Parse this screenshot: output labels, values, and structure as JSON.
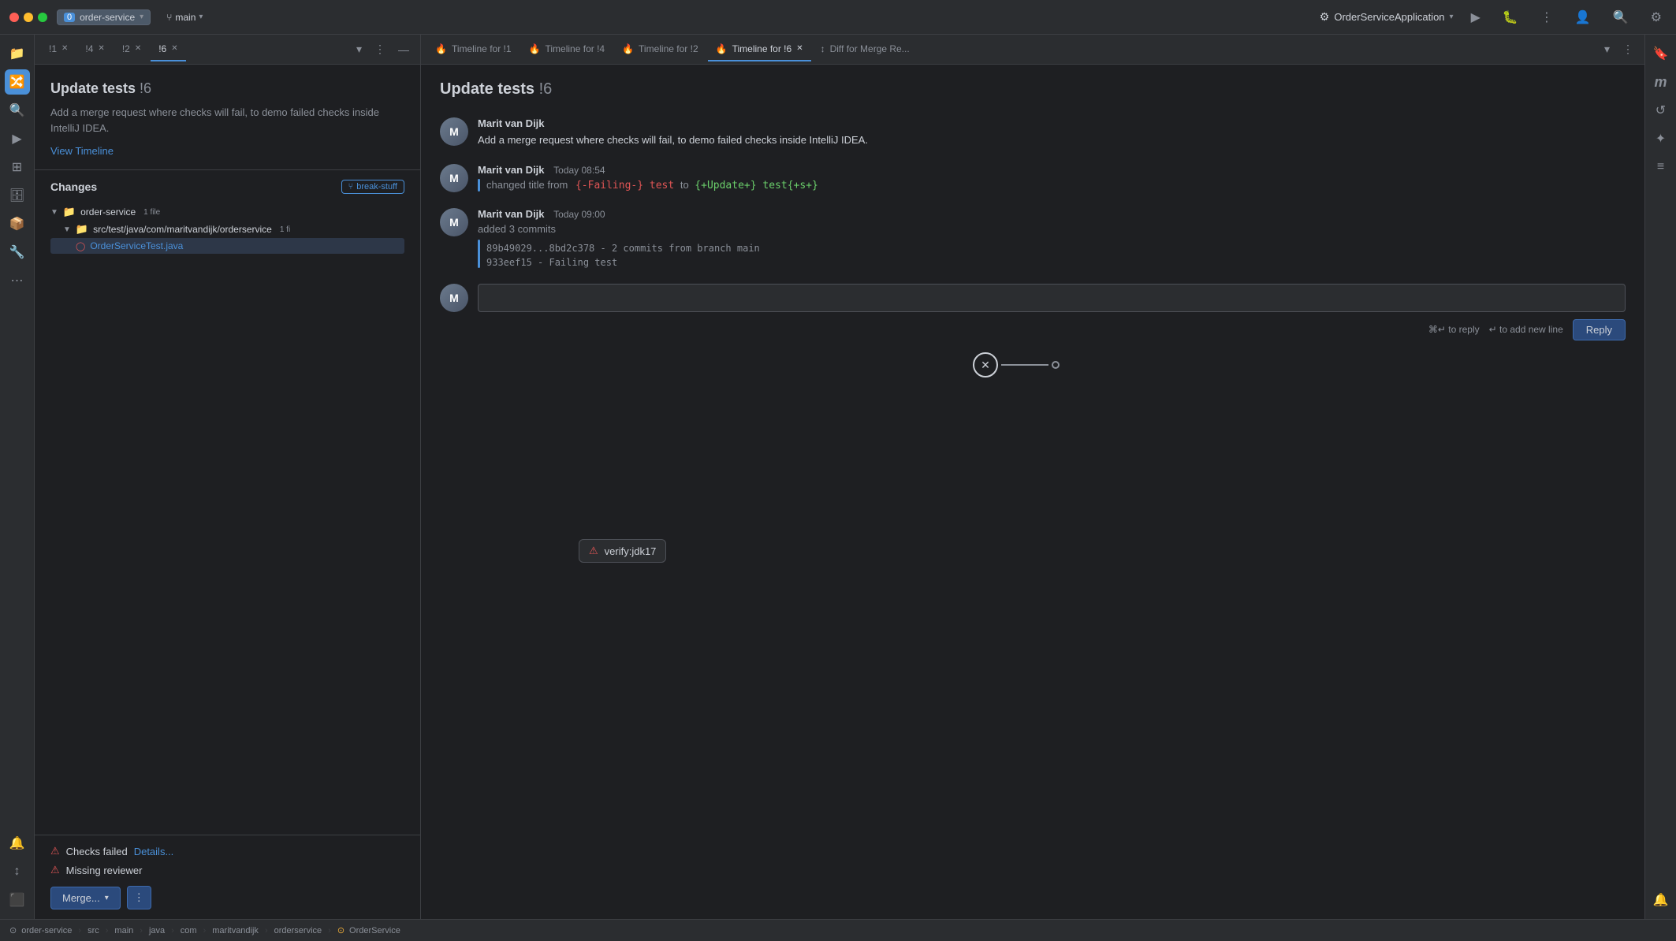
{
  "app": {
    "title": "OrderServiceApplication",
    "repo": "order-service",
    "repo_num": "0",
    "branch": "main"
  },
  "tabs": [
    {
      "id": "i1",
      "label": "!1",
      "active": false
    },
    {
      "id": "i4",
      "label": "!4",
      "active": false
    },
    {
      "id": "i2",
      "label": "!2",
      "active": false
    },
    {
      "id": "i6",
      "label": "!6",
      "active": true
    }
  ],
  "right_tabs": [
    {
      "id": "tl-i1",
      "label": "Timeline for !1",
      "active": false,
      "closeable": false
    },
    {
      "id": "tl-i4",
      "label": "Timeline for !4",
      "active": false,
      "closeable": false
    },
    {
      "id": "tl-i2",
      "label": "Timeline for !2",
      "active": false,
      "closeable": false
    },
    {
      "id": "tl-i6",
      "label": "Timeline for !6",
      "active": true,
      "closeable": true
    },
    {
      "id": "diff-mr",
      "label": "Diff for Merge Re...",
      "active": false,
      "closeable": false
    }
  ],
  "mr": {
    "title": "Update tests",
    "number": "!6",
    "description": "Add a merge request where checks will fail, to demo failed checks inside IntelliJ IDEA.",
    "view_timeline": "View Timeline",
    "changes_title": "Changes",
    "branch_tag": "break-stuff"
  },
  "file_tree": {
    "root": "order-service",
    "root_badge": "1 file",
    "folder": "src/test/java/com/maritvandijk/orderservice",
    "folder_badge": "1 fi",
    "file": "OrderServiceTest.java"
  },
  "checks": [
    {
      "status": "error",
      "label": "Checks failed",
      "link": "Details..."
    },
    {
      "status": "error",
      "label": "Missing reviewer",
      "link": ""
    }
  ],
  "merge_btn": "Merge...",
  "verify_popup": "verify:jdk17",
  "timeline": {
    "title": "Update tests",
    "number": "!6",
    "entries": [
      {
        "id": "e1",
        "author": "Marit van Dijk",
        "time": "",
        "text": "Add a merge request where checks will fail, to demo failed checks inside IntelliJ IDEA."
      },
      {
        "id": "e2",
        "author": "Marit van Dijk",
        "time": "Today 08:54",
        "type": "title_change",
        "change_label": "changed title from",
        "old_title": "{-Failing-} test",
        "new_title": "{+Update+} test{+s+}"
      },
      {
        "id": "e3",
        "author": "Marit van Dijk",
        "time": "Today 09:00",
        "type": "commits",
        "added_label": "added 3 commits",
        "commits": [
          "89b49029...8bd2c378 - 2 commits from branch main",
          "933eef15 - Failing test"
        ]
      }
    ]
  },
  "comment": {
    "placeholder": "",
    "hint_cmd": "⌘↵ to reply",
    "hint_newline": "↵ to add new line",
    "reply_btn": "Reply"
  },
  "status_bar": {
    "repo": "order-service",
    "breadcrumb": [
      "src",
      "main",
      "java",
      "com",
      "maritvandijk",
      "orderservice",
      "OrderService"
    ]
  }
}
